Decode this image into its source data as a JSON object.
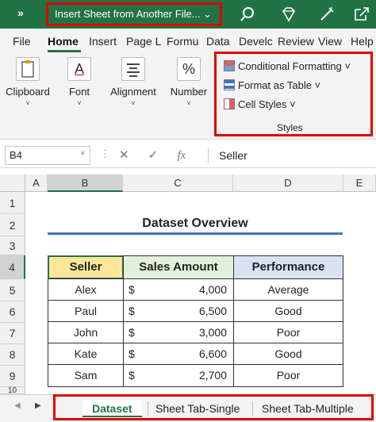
{
  "title_bar": {
    "menu_chevron": "»",
    "document_title": "Insert Sheet from Another File...",
    "title_dropdown": "⌄"
  },
  "ribbon_tabs": [
    "File",
    "Home",
    "Insert",
    "Page L",
    "Formu",
    "Data",
    "Develc",
    "Review",
    "View",
    "Help"
  ],
  "active_tab": "Home",
  "ribbon": {
    "clipboard": "Clipboard",
    "font": "Font",
    "alignment": "Alignment",
    "number": "Number",
    "number_glyph": "%",
    "font_glyph": "A",
    "conditional_formatting": "Conditional Formatting ˅",
    "format_as_table": "Format as Table ˅",
    "cell_styles": "Cell Styles ˅",
    "styles_group": "Styles",
    "caret": "˅"
  },
  "formula_bar": {
    "name_box": "B4",
    "name_box_dropdown": "˅",
    "more": "⋮",
    "cancel": "✕",
    "enter": "✓",
    "fx": "fx",
    "value": "Seller"
  },
  "columns": [
    "A",
    "B",
    "C",
    "D",
    "E"
  ],
  "rows": [
    "1",
    "2",
    "3",
    "4",
    "5",
    "6",
    "7",
    "8",
    "9",
    "10"
  ],
  "table": {
    "title": "Dataset Overview",
    "headers": [
      "Seller",
      "Sales Amount",
      "Performance"
    ],
    "currency_symbol": "$",
    "rows": [
      {
        "seller": "Alex",
        "amount": "4,000",
        "performance": "Average"
      },
      {
        "seller": "Paul",
        "amount": "6,500",
        "performance": "Good"
      },
      {
        "seller": "John",
        "amount": "3,000",
        "performance": "Poor"
      },
      {
        "seller": "Kate",
        "amount": "6,600",
        "performance": "Good"
      },
      {
        "seller": "Sam",
        "amount": "2,700",
        "performance": "Poor"
      }
    ]
  },
  "sheet_tabs": [
    "Dataset",
    "Sheet Tab-Single",
    "Sheet Tab-Multiple"
  ],
  "sheet_nav": {
    "prev": "◀",
    "next": "▶"
  },
  "colors": {
    "excel_green": "#217346",
    "highlight_red": "#e00000",
    "seller_header": "#ffe699",
    "sales_header": "#e2efda",
    "performance_header": "#d9e1f2"
  }
}
